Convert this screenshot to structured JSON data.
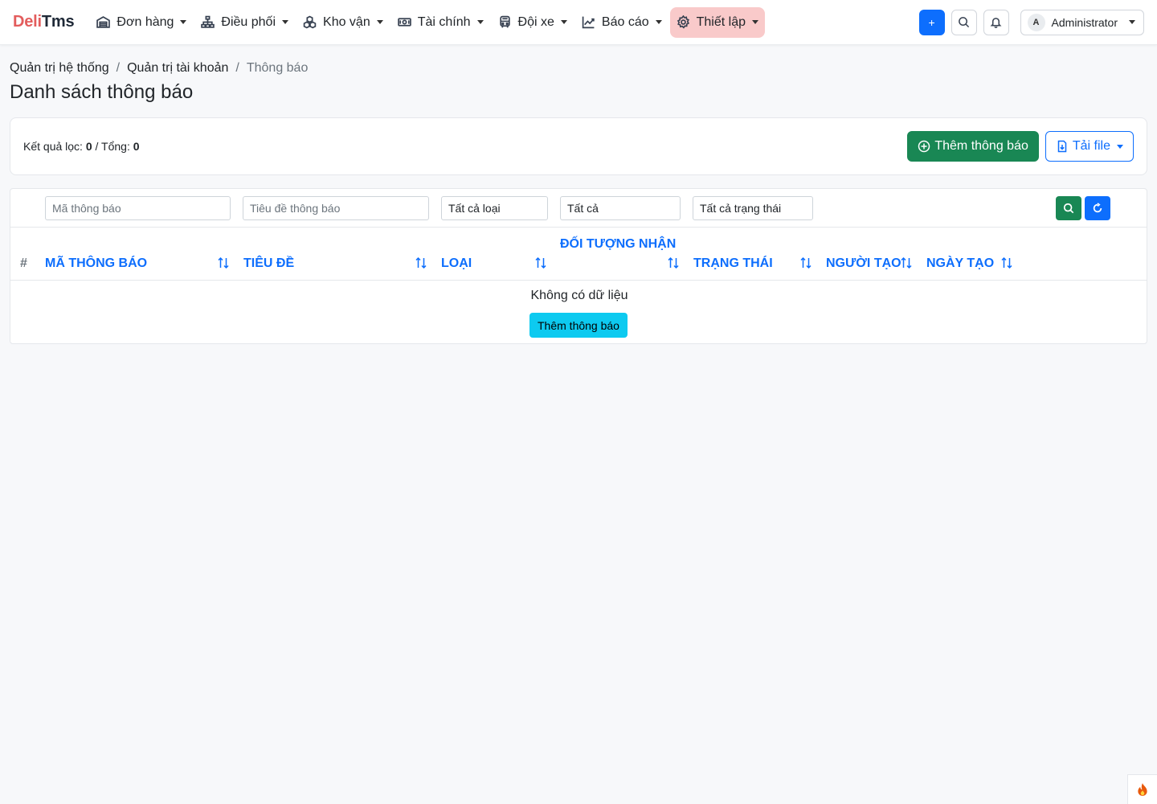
{
  "brand": {
    "part1": "Deli",
    "part2": "Tms"
  },
  "nav": {
    "items": [
      {
        "label": "Đơn hàng",
        "icon": "warehouse-icon"
      },
      {
        "label": "Điều phối",
        "icon": "sitemap-icon"
      },
      {
        "label": "Kho vận",
        "icon": "boxes-icon"
      },
      {
        "label": "Tài chính",
        "icon": "cash-icon"
      },
      {
        "label": "Đội xe",
        "icon": "bus-icon"
      },
      {
        "label": "Báo cáo",
        "icon": "chart-line-icon"
      },
      {
        "label": "Thiết lập",
        "icon": "gear-icon",
        "active": true
      }
    ]
  },
  "header_actions": {
    "add_label": "+",
    "user": {
      "initial": "A",
      "name": "Administrator"
    }
  },
  "breadcrumb": {
    "items": [
      "Quản trị hệ thống",
      "Quản trị tài khoản"
    ],
    "current": "Thông báo",
    "separator": "/"
  },
  "page": {
    "title": "Danh sách thông báo"
  },
  "summary": {
    "filtered_label": "Kết quả lọc:",
    "filtered_count": "0",
    "total_label": "Tổng:",
    "total_count": "0",
    "add_button": "Thêm thông báo",
    "download_button": "Tải file"
  },
  "filters": {
    "code_placeholder": "Mã thông báo",
    "title_placeholder": "Tiêu đề thông báo",
    "type_value": "Tất cả loại",
    "target_value": "Tất cả",
    "status_value": "Tất cả trạng thái"
  },
  "table": {
    "columns": {
      "index": "#",
      "code": "Mã thông báo",
      "title": "Tiêu đề",
      "type": "Loại",
      "target": "Đối tượng nhận",
      "status": "Trạng thái",
      "creator": "Người tạo",
      "created_at": "Ngày tạo"
    },
    "empty_message": "Không có dữ liệu",
    "empty_add_button": "Thêm thông báo"
  },
  "colors": {
    "brand_red": "#e35d5d",
    "primary": "#0d6efd",
    "success": "#198754",
    "info": "#0dcaf0",
    "active_nav_bg": "#f9caca"
  }
}
